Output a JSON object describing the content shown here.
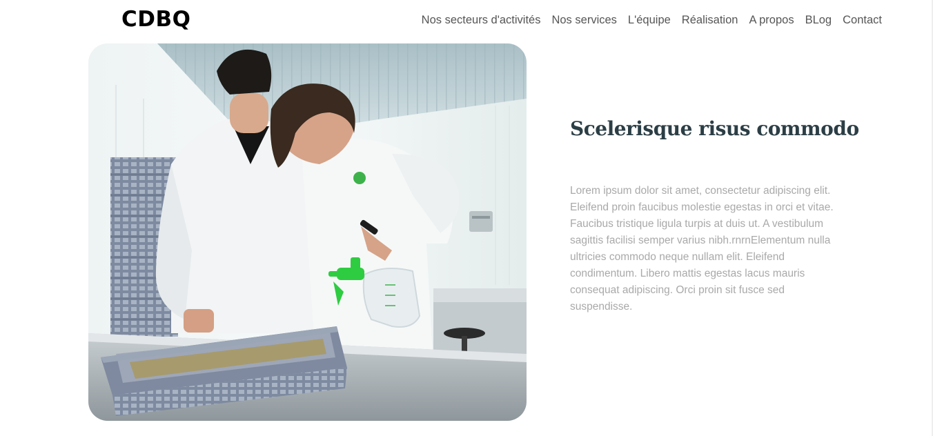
{
  "header": {
    "logo": "CDBQ",
    "nav": [
      "Nos secteurs d'activités",
      "Nos services",
      "L'équipe",
      "Réalisation",
      "A propos",
      "BLog",
      "Contact"
    ]
  },
  "section": {
    "title": "Scelerisque risus commodo",
    "body": "Lorem ipsum dolor sit amet, consectetur adipiscing elit. Eleifend proin faucibus molestie egestas in orci et vitae. Faucibus tristique ligula turpis at duis ut. A vestibulum sagittis facilisi semper varius nibh.rnrnElementum nulla ultricies commodo neque nullam elit. Eleifend condimentum. Libero mattis egestas lacus mauris consequat adipiscing. Orci proin sit fusce sed suspendisse."
  },
  "colors": {
    "title": "#2c3e45",
    "body_text": "#a9a9a9",
    "nav_text": "#555555",
    "sprayer_accent": "#2ecc40"
  }
}
